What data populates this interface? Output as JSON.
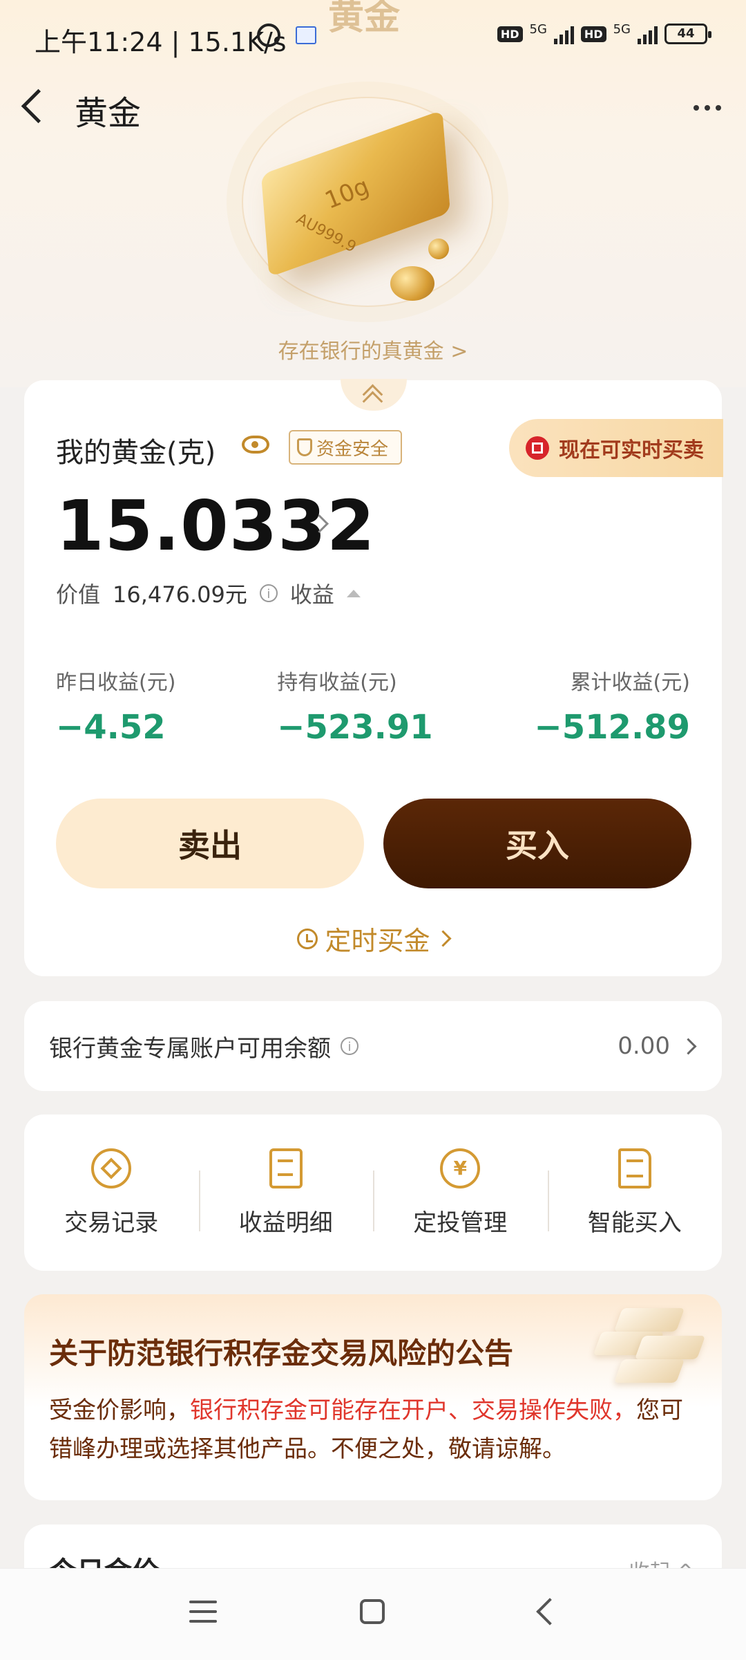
{
  "status_bar": {
    "time": "上午11:24 | 15.1K/s",
    "network_type": "5G",
    "hd": "HD",
    "battery": "44"
  },
  "header": {
    "ghost_title": "黄金",
    "title": "黄金"
  },
  "hero": {
    "bar_weight": "10g",
    "bar_purity": "AU999.9",
    "tagline": "存在银行的真黄金 >"
  },
  "holdings": {
    "label": "我的黄金(克)",
    "safety_badge": "资金安全",
    "realtime_tag": "现在可实时买卖",
    "amount": "15.0332",
    "value_label": "价值",
    "value": "16,476.09元",
    "profit_toggle": "收益",
    "stats": [
      {
        "label": "昨日收益(元)",
        "value": "−4.52"
      },
      {
        "label": "持有收益(元)",
        "value": "−523.91"
      },
      {
        "label": "累计收益(元)",
        "value": "−512.89"
      }
    ],
    "sell_label": "卖出",
    "buy_label": "买入",
    "scheduled_buy": "定时买金"
  },
  "balance": {
    "label": "银行黄金专属账户可用余额",
    "value": "0.00"
  },
  "menu": [
    {
      "label": "交易记录",
      "icon": "record-icon"
    },
    {
      "label": "收益明细",
      "icon": "detail-icon"
    },
    {
      "label": "定投管理",
      "icon": "plan-icon"
    },
    {
      "label": "智能买入",
      "icon": "smart-buy-icon"
    }
  ],
  "notice": {
    "title": "关于防范银行积存金交易风险的公告",
    "body_prefix": "受金价影响，",
    "body_highlight": "银行积存金可能存在开户、交易操作失败，",
    "body_suffix": "您可错峰办理或选择其他产品。不便之处，敬请谅解。"
  },
  "today_price": {
    "title": "今日金价",
    "collapse": "收起 ^"
  },
  "colors": {
    "accent": "#c28a2b",
    "profit_negative": "#1e9a6e",
    "buy_bg": "#4a1f04",
    "sell_bg": "#fdebd0",
    "highlight": "#e0362c"
  }
}
